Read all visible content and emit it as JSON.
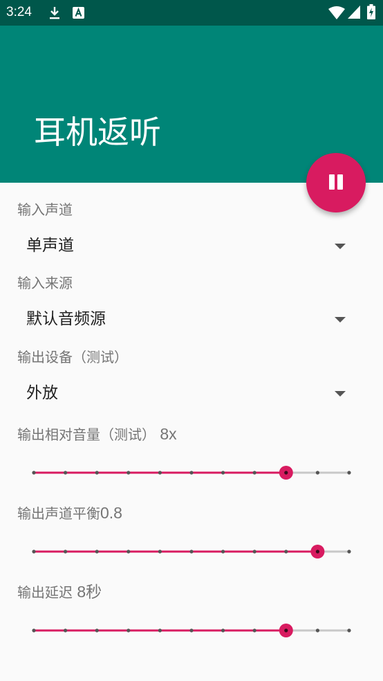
{
  "status_bar": {
    "time": "3:24",
    "icons": [
      "download-icon",
      "a-box-icon",
      "wifi-icon",
      "signal-icon",
      "battery-charging-icon"
    ]
  },
  "app_bar": {
    "title": "耳机返听"
  },
  "fab": {
    "icon": "pause-icon"
  },
  "input_channel": {
    "label": "输入声道",
    "value": "单声道"
  },
  "input_source": {
    "label": "输入来源",
    "value": "默认音频源"
  },
  "output_device": {
    "label": "输出设备（测试）",
    "value": "外放"
  },
  "output_volume": {
    "label": "输出相对音量（测试）",
    "value_text": "8x",
    "value": 8,
    "max": 10
  },
  "output_balance": {
    "label": "输出声道平衡",
    "value_text": "0.8",
    "value": 9,
    "max": 10
  },
  "output_delay": {
    "label": "输出延迟",
    "value_text": "8秒",
    "value": 8,
    "max": 10
  },
  "colors": {
    "status_bar": "#00574B",
    "app_bar": "#008577",
    "accent": "#D81B60",
    "slider_track": "#C8C8C8",
    "background": "#FAFAFA"
  }
}
